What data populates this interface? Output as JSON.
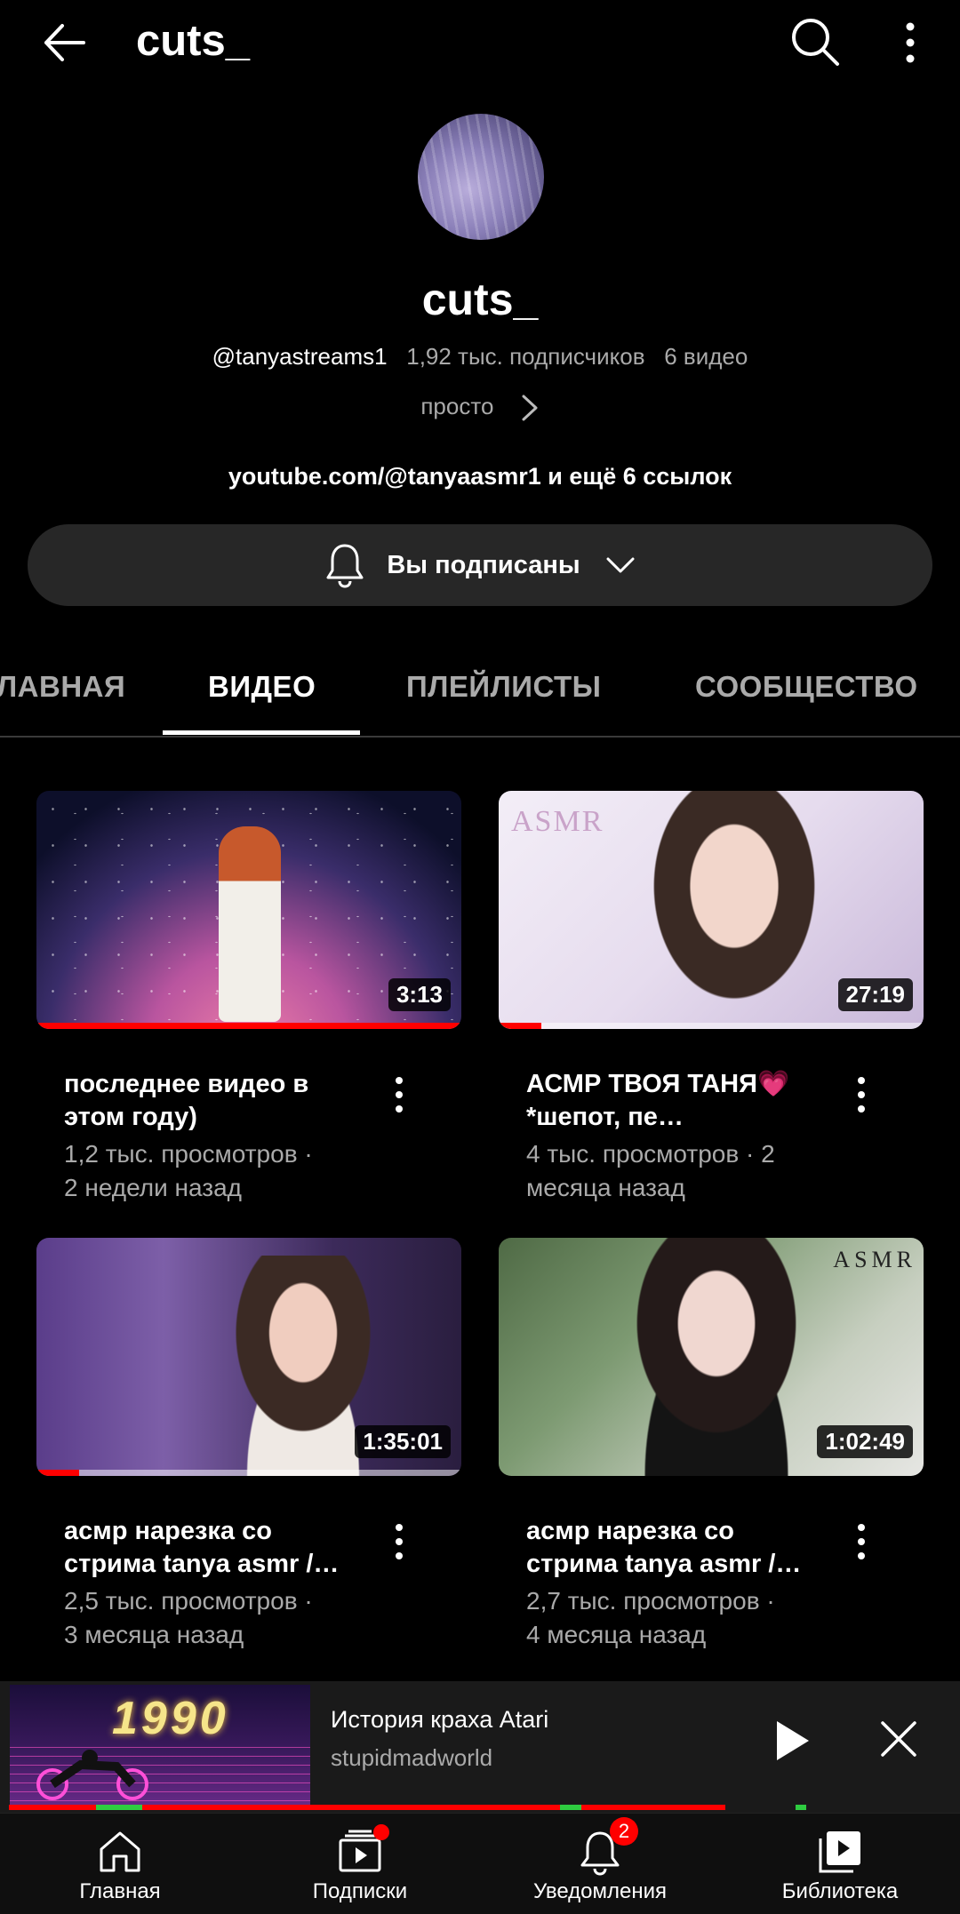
{
  "header": {
    "title": "cuts_"
  },
  "channel": {
    "name": "cuts_",
    "handle": "@tanyastreams1",
    "subscribers": "1,92 тыс. подписчиков",
    "video_count": "6 видео",
    "description": "просто",
    "links": "youtube.com/@tanyaasmr1 и ещё 6 ссылок",
    "subscribe_label": "Вы подписаны"
  },
  "tabs": [
    {
      "label": "ЛАВНАЯ"
    },
    {
      "label": "ВИДЕО",
      "active": true
    },
    {
      "label": "ПЛЕЙЛИСТЫ"
    },
    {
      "label": "СООБЩЕСТВО"
    }
  ],
  "videos": [
    {
      "title": "последнее видео в этом году)",
      "views": "1,2 тыс. просмотров ·",
      "age": "2 недели назад",
      "duration": "3:13",
      "watched": 1.0
    },
    {
      "title": "АСМР ТВОЯ ТАНЯ💗 *шепот, пе…",
      "views": "4 тыс. просмотров · 2",
      "age": "месяца назад",
      "duration": "27:19",
      "watched": 0.1
    },
    {
      "title": "асмр нарезка со стрима tanya asmr /…",
      "views": "2,5 тыс. просмотров ·",
      "age": "3 месяца назад",
      "duration": "1:35:01",
      "watched": 0.1
    },
    {
      "title": "асмр нарезка со стрима tanya asmr /…",
      "views": "2,7 тыс. просмотров ·",
      "age": "4 месяца назад",
      "duration": "1:02:49",
      "watched": 0
    }
  ],
  "thumb_text": {
    "asmr_1": "ASMR",
    "asmr_4": "ASMR"
  },
  "mini_player": {
    "title": "История краха Atari",
    "channel": "stupidmadworld",
    "thumb_text": "1990",
    "progress": 0.75
  },
  "bottom_nav": [
    {
      "label": "Главная",
      "icon": "home-icon"
    },
    {
      "label": "Подписки",
      "icon": "subscriptions-icon",
      "dot": true
    },
    {
      "label": "Уведомления",
      "icon": "bell-icon",
      "badge": "2"
    },
    {
      "label": "Библиотека",
      "icon": "library-icon"
    }
  ],
  "colors": {
    "accent": "#ff0000",
    "background": "#000000",
    "secondary_text": "#aaaaaa",
    "button_bg": "#272727"
  }
}
